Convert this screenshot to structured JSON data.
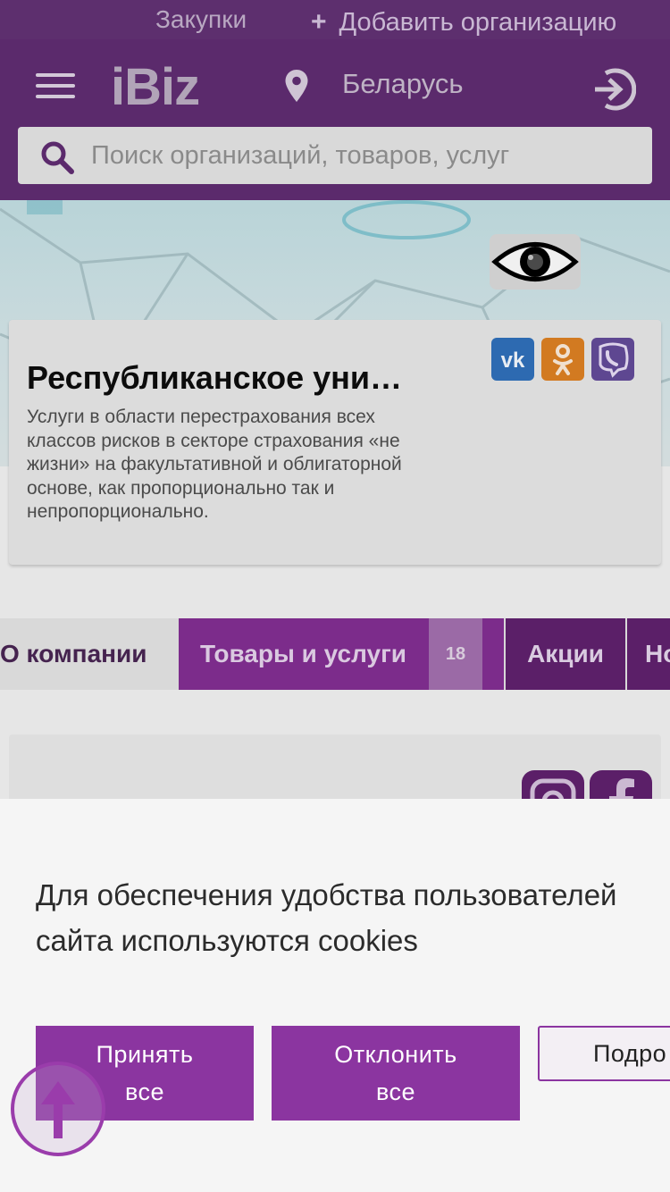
{
  "top_strip": {
    "purchases_label": "Закупки",
    "add_org_label": "Добавить организацию"
  },
  "header": {
    "logo": "iBiz",
    "region": "Беларусь",
    "search_placeholder": "Поиск организаций, товаров, услуг"
  },
  "company": {
    "title": "Республиканское уни…",
    "description": "Услуги в области перестрахования всех классов рисков в секторе страхования «не жизни» на факультативной и облигаторной основе, как пропорционально так и непропорционально.",
    "social": [
      "vk-icon",
      "ok-icon",
      "viber-icon"
    ]
  },
  "tabs": [
    {
      "label": "О компании"
    },
    {
      "label": "Товары и услуги",
      "count": "18"
    },
    {
      "label": "Акции"
    },
    {
      "label": "Но"
    }
  ],
  "cookie": {
    "message": "Для обеспечения удобства пользователей сайта используются cookies",
    "accept_label": "Принять все",
    "decline_label": "Отклонить все",
    "more_label": "Подро"
  },
  "colors": {
    "header_bg": "#5b2a6c",
    "accent": "#8b35a0",
    "tab_active": "#7c2c8b",
    "tab_dark": "#5b1f68"
  }
}
